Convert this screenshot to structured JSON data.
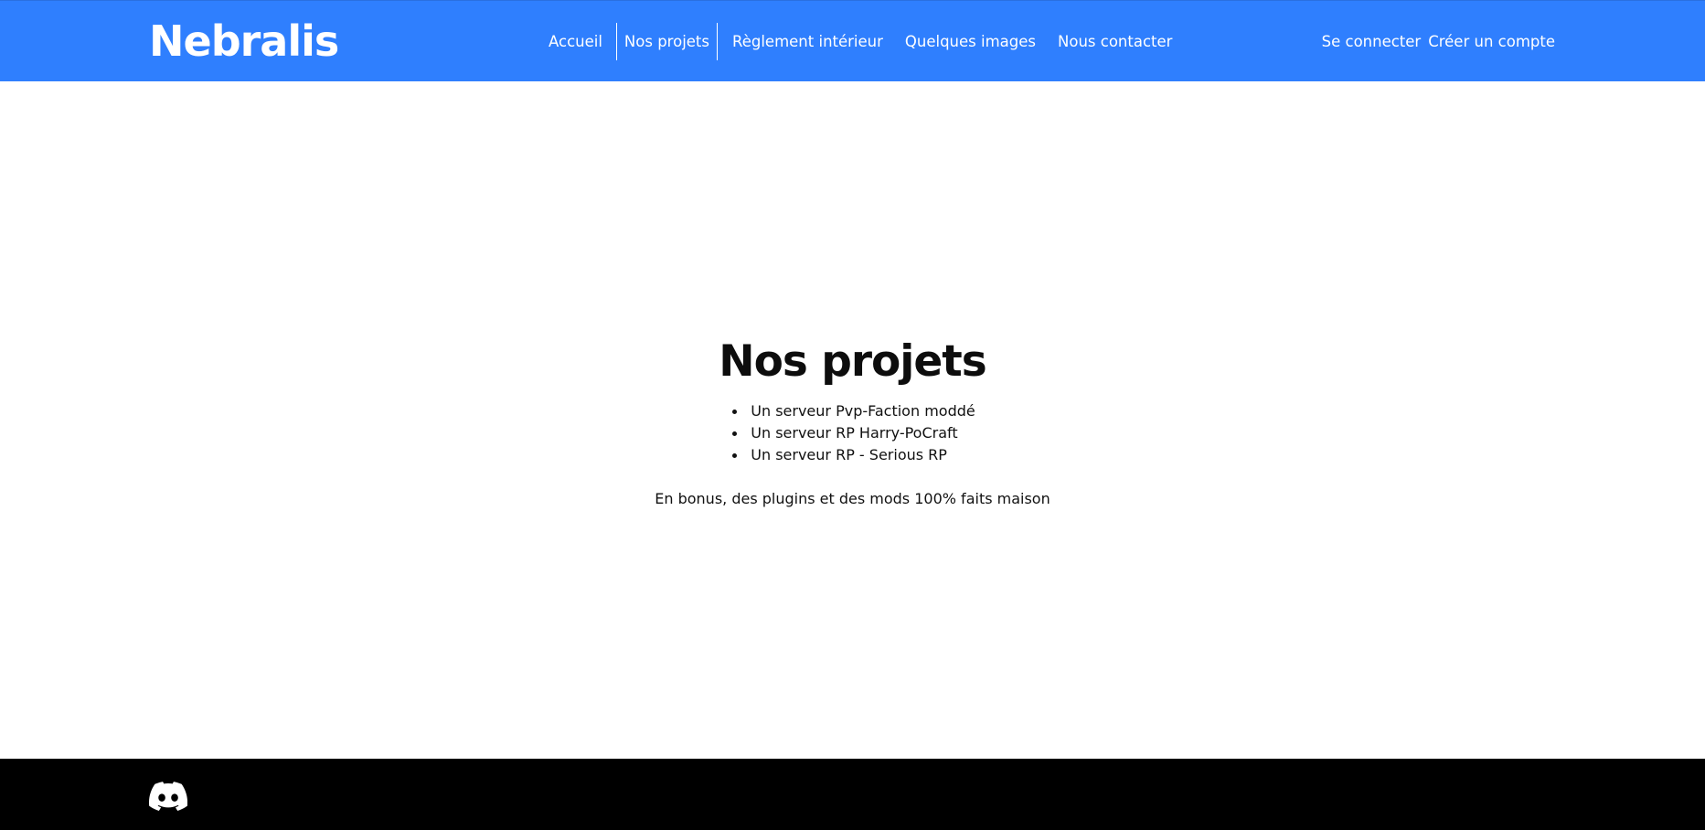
{
  "header": {
    "brand": "Nebralis",
    "nav": [
      {
        "label": "Accueil"
      },
      {
        "label": "Nos projets",
        "active": true
      },
      {
        "label": "Règlement intérieur"
      },
      {
        "label": "Quelques images"
      },
      {
        "label": "Nous contacter"
      }
    ],
    "auth": {
      "login": "Se connecter",
      "register": "Créer un compte"
    },
    "background_color": "#2f7ffe"
  },
  "main": {
    "title": "Nos projets",
    "projects": [
      "Un serveur Pvp-Faction moddé",
      "Un serveur RP Harry-PoCraft",
      "Un serveur RP - Serious RP"
    ],
    "bonus": "En bonus, des plugins et des mods 100% faits maison"
  },
  "footer": {
    "icons": [
      "discord-icon"
    ],
    "background_color": "#000000"
  }
}
